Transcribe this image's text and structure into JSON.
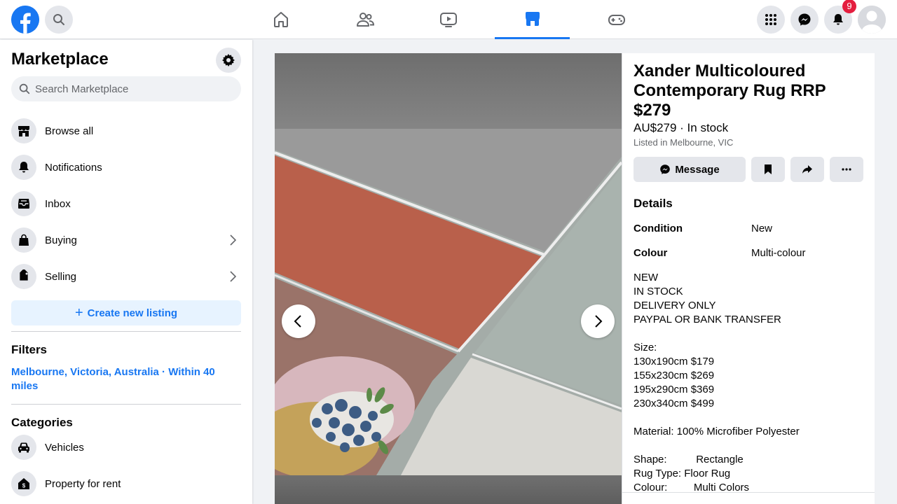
{
  "topbar": {
    "icons": [
      "facebook-logo",
      "search-icon",
      "home-icon",
      "friends-icon",
      "watch-icon",
      "marketplace-icon",
      "gaming-icon",
      "menu-grid-icon",
      "messenger-icon",
      "bell-icon"
    ],
    "notification_count": "9"
  },
  "sidebar": {
    "title": "Marketplace",
    "search_placeholder": "Search Marketplace",
    "items": [
      {
        "label": "Browse all",
        "icon": "shop-icon"
      },
      {
        "label": "Notifications",
        "icon": "bell-icon"
      },
      {
        "label": "Inbox",
        "icon": "inbox-icon"
      },
      {
        "label": "Buying",
        "icon": "bag-icon"
      },
      {
        "label": "Selling",
        "icon": "tag-icon"
      }
    ],
    "create_label": "Create new listing",
    "filters_heading": "Filters",
    "filter_location": "Melbourne, Victoria, Australia · Within 40 miles",
    "categories_heading": "Categories",
    "categories": [
      {
        "label": "Vehicles",
        "icon": "car-icon"
      },
      {
        "label": "Property for rent",
        "icon": "house-dollar-icon"
      }
    ]
  },
  "listing": {
    "title": "Xander Multicoloured Contemporary Rug RRP $279",
    "price_stock": "AU$279 · In stock",
    "location": "Listed in Melbourne, VIC",
    "message_label": "Message",
    "details_heading": "Details",
    "condition_label": "Condition",
    "condition_value": "New",
    "colour_label": "Colour",
    "colour_value": "Multi-colour",
    "description_lines": [
      "NEW",
      "IN STOCK",
      "DELIVERY ONLY",
      "PAYPAL OR BANK TRANSFER",
      "",
      "Size:",
      "130x190cm $179",
      "155x230cm $269",
      "195x290cm $369",
      "230x340cm $499",
      "",
      "Material: 100% Microfiber Polyester",
      "",
      "Shape:          Rectangle",
      "Rug Type: Floor Rug",
      "Colour:         Multi Colors"
    ]
  },
  "colors": {
    "brand": "#1877f2",
    "badge": "#e41e3f",
    "rug_grey": "#9a9a9a",
    "rug_terracotta": "#b9604b",
    "rug_sage": "#a9b3ae"
  }
}
